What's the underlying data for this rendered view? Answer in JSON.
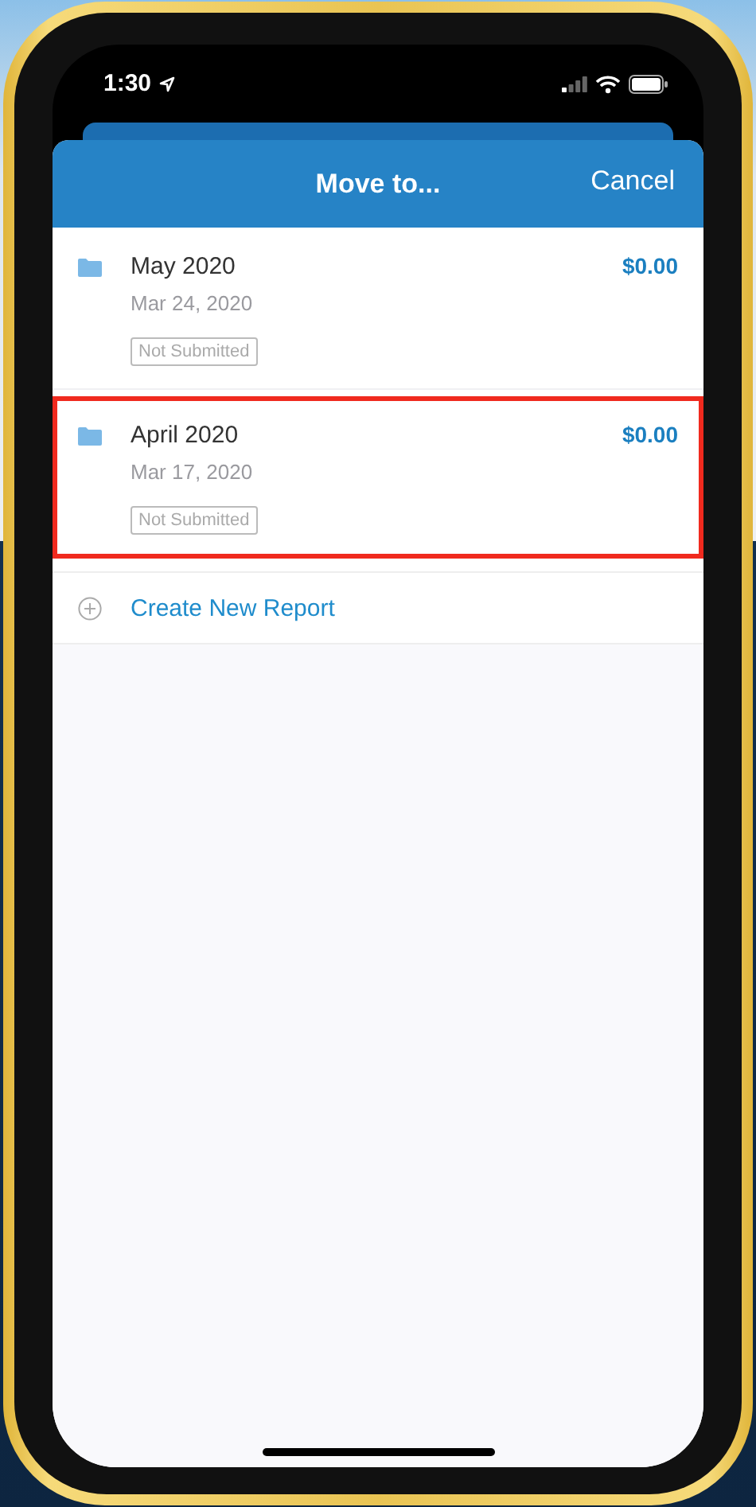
{
  "status_bar": {
    "time": "1:30"
  },
  "header": {
    "title": "Move to...",
    "cancel": "Cancel"
  },
  "reports": [
    {
      "name": "May 2020",
      "date": "Mar 24, 2020",
      "status": "Not Submitted",
      "amount": "$0.00",
      "highlighted": false
    },
    {
      "name": "April 2020",
      "date": "Mar 17, 2020",
      "status": "Not Submitted",
      "amount": "$0.00",
      "highlighted": true
    }
  ],
  "create_action": {
    "label": "Create New Report"
  }
}
